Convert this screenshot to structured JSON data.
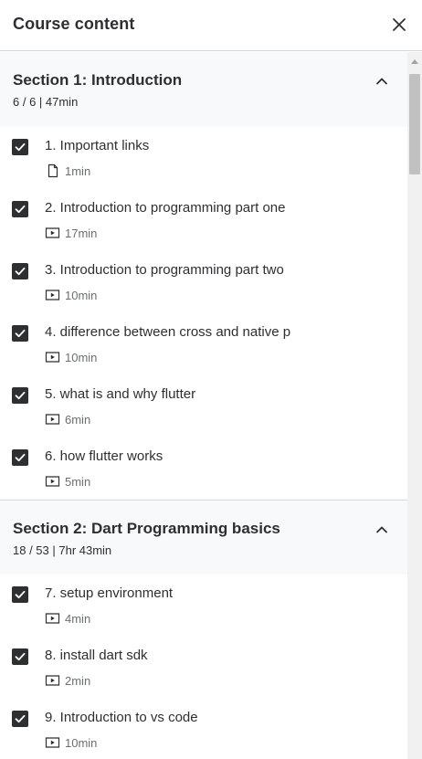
{
  "header": {
    "title": "Course content",
    "close_icon": "close-icon"
  },
  "sections": [
    {
      "title": "Section 1: Introduction",
      "meta": "6 / 6 | 47min",
      "expanded": true,
      "lectures": [
        {
          "title": "1. Important links",
          "type": "article",
          "duration": "1min",
          "completed": true
        },
        {
          "title": "2. Introduction to programming part one",
          "type": "video",
          "duration": "17min",
          "completed": true
        },
        {
          "title": "3. Introduction to programming part two",
          "type": "video",
          "duration": "10min",
          "completed": true
        },
        {
          "title": "4. difference between cross and native p",
          "type": "video",
          "duration": "10min",
          "completed": true
        },
        {
          "title": "5. what is and why flutter",
          "type": "video",
          "duration": "6min",
          "completed": true
        },
        {
          "title": "6. how flutter works",
          "type": "video",
          "duration": "5min",
          "completed": true
        }
      ]
    },
    {
      "title": "Section 2: Dart Programming basics",
      "meta": "18 / 53 | 7hr 43min",
      "expanded": true,
      "lectures": [
        {
          "title": "7. setup environment",
          "type": "video",
          "duration": "4min",
          "completed": true
        },
        {
          "title": "8. install dart sdk",
          "type": "video",
          "duration": "2min",
          "completed": true
        },
        {
          "title": "9. Introduction to vs code",
          "type": "video",
          "duration": "10min",
          "completed": true
        }
      ]
    }
  ],
  "colors": {
    "text": "#2d2f31",
    "muted": "#6a6f73",
    "section_bg": "#f7f9fa",
    "border": "#d1d7dc"
  }
}
